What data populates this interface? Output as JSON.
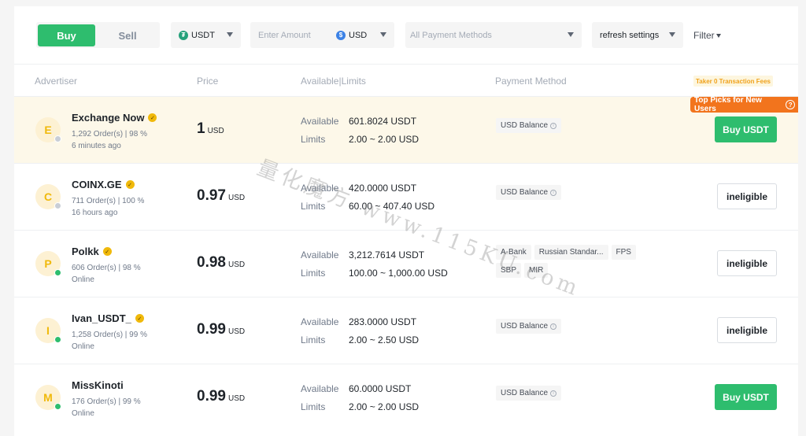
{
  "tabs": {
    "buy": "Buy",
    "sell": "Sell"
  },
  "filters": {
    "asset": "USDT",
    "amount_placeholder": "Enter Amount",
    "fiat": "USD",
    "payment": "All Payment Methods",
    "refresh": "refresh settings",
    "filter": "Filter"
  },
  "headers": {
    "advertiser": "Advertiser",
    "price": "Price",
    "available": "Available|Limits",
    "payment": "Payment Method",
    "taker_note": "Taker 0 Transaction Fees"
  },
  "labels": {
    "available": "Available",
    "limits": "Limits"
  },
  "top_picks": "Top Picks for New Users",
  "watermark": "量化魔方 www.115KU.com",
  "colors": {
    "buy_green": "#2ebd6e",
    "badge_gold": "#f0b90b",
    "promo_orange": "#f2741d",
    "online": "#2ebd6e",
    "offline": "#c9ced6"
  },
  "rows": [
    {
      "initial": "E",
      "name": "Exchange Now",
      "verified": true,
      "stats": "1,292 Order(s)  |  98 %",
      "status": "6 minutes ago",
      "online": false,
      "price": "1",
      "currency": "USD",
      "available": "601.8024 USDT",
      "limits": "2.00 ~ 2.00 USD",
      "payment": [
        "USD Balance"
      ],
      "action": "Buy USDT",
      "featured": true
    },
    {
      "initial": "C",
      "name": "COINX.GE",
      "verified": true,
      "stats": "711 Order(s)  |  100 %",
      "status": "16 hours ago",
      "online": false,
      "price": "0.97",
      "currency": "USD",
      "available": "420.0000 USDT",
      "limits": "60.00 ~ 407.40 USD",
      "payment": [
        "USD Balance"
      ],
      "action": "ineligible",
      "featured": false
    },
    {
      "initial": "P",
      "name": "Polkk",
      "verified": true,
      "stats": "606 Order(s)  |  98 %",
      "status": "Online",
      "online": true,
      "price": "0.98",
      "currency": "USD",
      "available": "3,212.7614 USDT",
      "limits": "100.00 ~ 1,000.00 USD",
      "payment": [
        "A-Bank",
        "Russian Standar...",
        "FPS",
        "SBP",
        "MIR"
      ],
      "action": "ineligible",
      "featured": false
    },
    {
      "initial": "I",
      "name": "Ivan_USDT_",
      "verified": true,
      "stats": "1,258 Order(s)  |  99 %",
      "status": "Online",
      "online": true,
      "price": "0.99",
      "currency": "USD",
      "available": "283.0000 USDT",
      "limits": "2.00 ~ 2.50 USD",
      "payment": [
        "USD Balance"
      ],
      "action": "ineligible",
      "featured": false
    },
    {
      "initial": "M",
      "name": "MissKinoti",
      "verified": false,
      "stats": "176 Order(s)  |  99 %",
      "status": "Online",
      "online": true,
      "price": "0.99",
      "currency": "USD",
      "available": "60.0000 USDT",
      "limits": "2.00 ~ 2.00 USD",
      "payment": [
        "USD Balance"
      ],
      "action": "Buy USDT",
      "featured": false
    }
  ]
}
